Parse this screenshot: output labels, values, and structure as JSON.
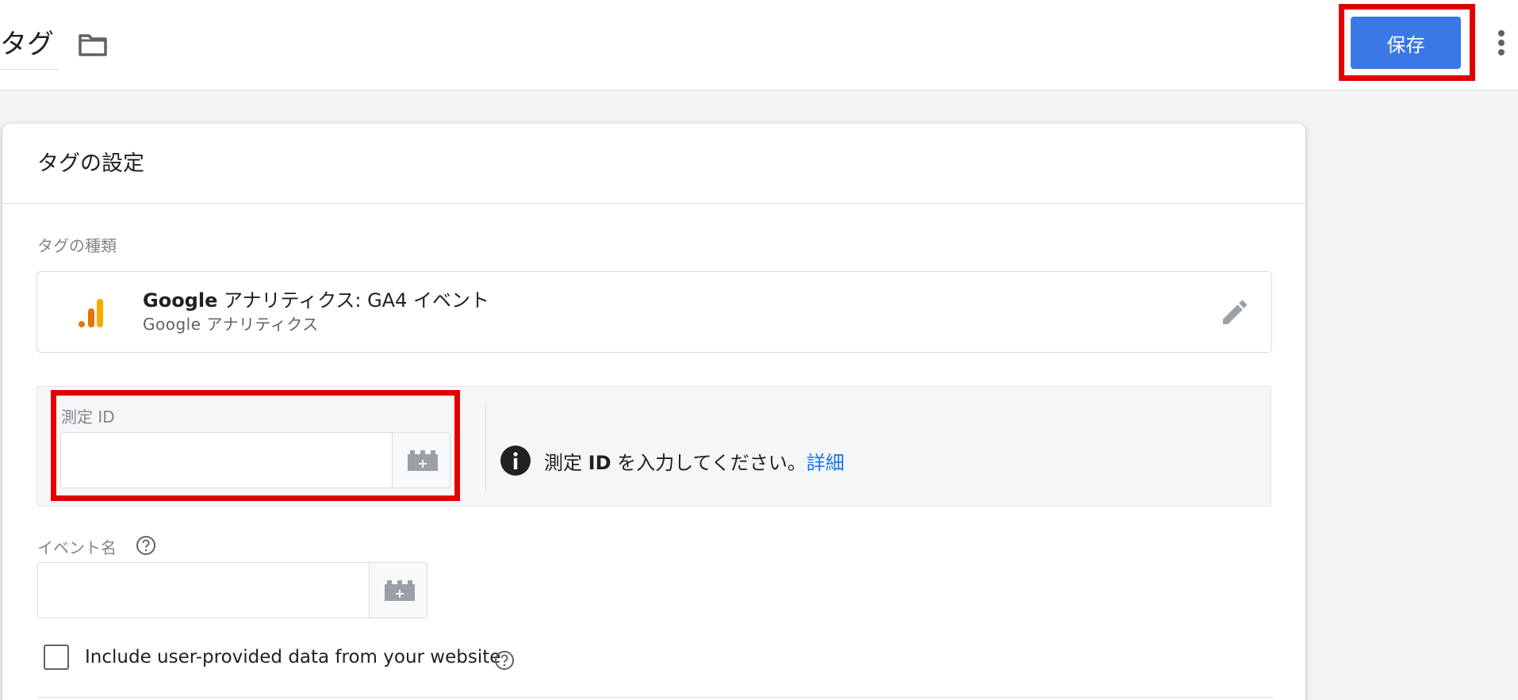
{
  "header": {
    "title": "タグ",
    "save_label": "保存"
  },
  "card": {
    "title": "タグの設定",
    "tag_type_label": "タグの種類",
    "tag_type": {
      "name_bold": "Google",
      "name_rest": " アナリティクス: GA4 イベント",
      "subtitle": "Google アナリティクス"
    },
    "measurement": {
      "label": "測定 ID",
      "value": "",
      "info_prefix": "測定 ",
      "info_bold": "ID",
      "info_suffix": " を入力してください。",
      "info_link": "詳細"
    },
    "event": {
      "label": "イベント名",
      "value": ""
    },
    "user_data": {
      "label": "Include user-provided data from your website",
      "checked": false
    }
  },
  "colors": {
    "accent": "#3b78e7",
    "highlight": "#e00000",
    "link": "#1a73e8",
    "ga_dark": "#e37400",
    "ga_light": "#f9ab00"
  },
  "icons": [
    "folder-icon",
    "more-vert-icon",
    "google-analytics-icon",
    "edit-pencil-icon",
    "add-variable-icon",
    "info-icon",
    "help-icon"
  ]
}
